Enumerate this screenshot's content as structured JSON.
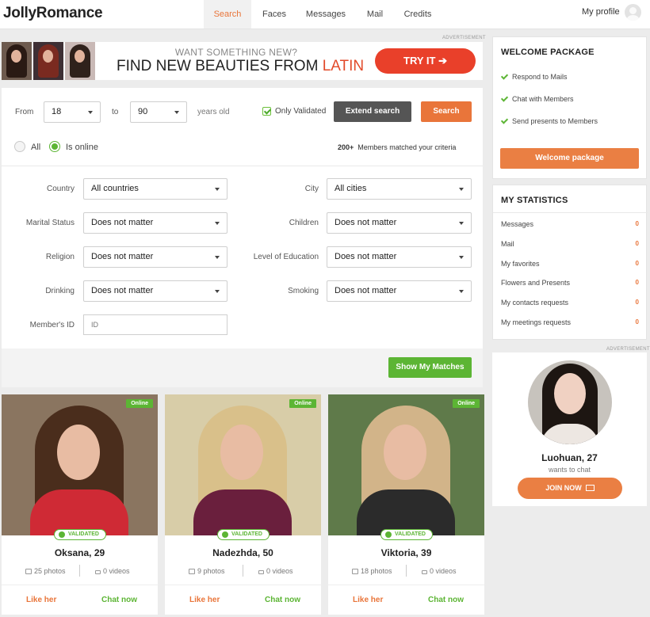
{
  "header": {
    "logo": "JollyRomance",
    "nav": [
      "Search",
      "Faces",
      "Messages",
      "Mail",
      "Credits"
    ],
    "active_nav": "Search",
    "my_profile": "My profile"
  },
  "ad_label": "ADVERTISEMENT",
  "banner": {
    "subtitle": "WANT SOMETHING NEW?",
    "title_main": "FIND NEW BEAUTIES FROM ",
    "title_highlight": "LATIN",
    "cta": "TRY IT ➔"
  },
  "filters": {
    "from_label": "From",
    "age_from": "18",
    "to_label": "to",
    "age_to": "90",
    "years_label": "years old",
    "only_validated": "Only Validated",
    "extend_search": "Extend search",
    "search": "Search",
    "radio_all": "All",
    "radio_online": "Is online",
    "match_count": "200+",
    "match_text": "Members matched your criteria",
    "country_label": "Country",
    "country_value": "All countries",
    "city_label": "City",
    "city_value": "All cities",
    "marital_label": "Marital Status",
    "marital_value": "Does not matter",
    "children_label": "Children",
    "children_value": "Does not matter",
    "religion_label": "Religion",
    "religion_value": "Does not matter",
    "education_label": "Level of Education",
    "education_value": "Does not matter",
    "drinking_label": "Drinking",
    "drinking_value": "Does not matter",
    "smoking_label": "Smoking",
    "smoking_value": "Does not matter",
    "member_id_label": "Member's ID",
    "member_id_placeholder": "ID",
    "show_matches": "Show My Matches"
  },
  "profiles": [
    {
      "name": "Oksana, 29",
      "photos": "25 photos",
      "videos": "0 videos",
      "online": "Online",
      "validated": "VALIDATED",
      "like": "Like her",
      "chat": "Chat now"
    },
    {
      "name": "Nadezhda, 50",
      "photos": "9 photos",
      "videos": "0 videos",
      "online": "Online",
      "validated": "VALIDATED",
      "like": "Like her",
      "chat": "Chat now"
    },
    {
      "name": "Viktoria, 39",
      "photos": "18 photos",
      "videos": "0 videos",
      "online": "Online",
      "validated": "VALIDATED",
      "like": "Like her",
      "chat": "Chat now"
    }
  ],
  "welcome": {
    "title": "WELCOME PACKAGE",
    "items": [
      "Respond to Mails",
      "Chat with Members",
      "Send presents to Members"
    ],
    "button": "Welcome package"
  },
  "stats": {
    "title": "MY STATISTICS",
    "rows": [
      {
        "label": "Messages",
        "value": "0"
      },
      {
        "label": "Mail",
        "value": "0"
      },
      {
        "label": "My favorites",
        "value": "0"
      },
      {
        "label": "Flowers and Presents",
        "value": "0"
      },
      {
        "label": "My contacts requests",
        "value": "0"
      },
      {
        "label": "My meetings requests",
        "value": "0"
      }
    ]
  },
  "promo": {
    "name": "Luohuan, 27",
    "subtitle": "wants to chat",
    "cta": "JOIN NOW"
  },
  "colors": {
    "accent_orange": "#e9753a",
    "online_green": "#5cb534",
    "banner_red": "#e9402a",
    "extend_gray": "#555555"
  }
}
